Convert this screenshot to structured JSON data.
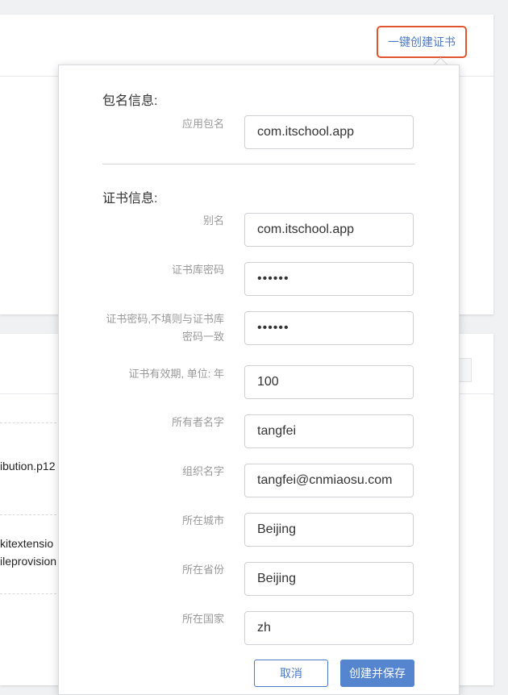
{
  "header": {
    "create_cert_link": "一键创建证书"
  },
  "background_files": [
    "ibution.p12",
    "kitextensio",
    "ileprovision"
  ],
  "form": {
    "package_section_title": "包名信息:",
    "cert_section_title": "证书信息:",
    "fields": [
      {
        "label": "应用包名",
        "value": "com.itschool.app"
      },
      {
        "label": "别名",
        "value": "com.itschool.app"
      },
      {
        "label": "证书库密码",
        "value": "••••••"
      },
      {
        "label": "证书密码,不填则与证书库密码一致",
        "value": "••••••"
      },
      {
        "label": "证书有效期, 单位: 年",
        "value": "100"
      },
      {
        "label": "所有者名字",
        "value": "tangfei"
      },
      {
        "label": "组织名字",
        "value": "tangfei@cnmiaosu.com"
      },
      {
        "label": "所在城市",
        "value": "Beijing"
      },
      {
        "label": "所在省份",
        "value": "Beijing"
      },
      {
        "label": "所在国家",
        "value": "zh"
      }
    ],
    "cancel_label": "取消",
    "save_label": "创建并保存"
  },
  "colors": {
    "accent": "#4a79c8",
    "highlight_border": "#e0552f",
    "primary_button": "#5585cf"
  }
}
